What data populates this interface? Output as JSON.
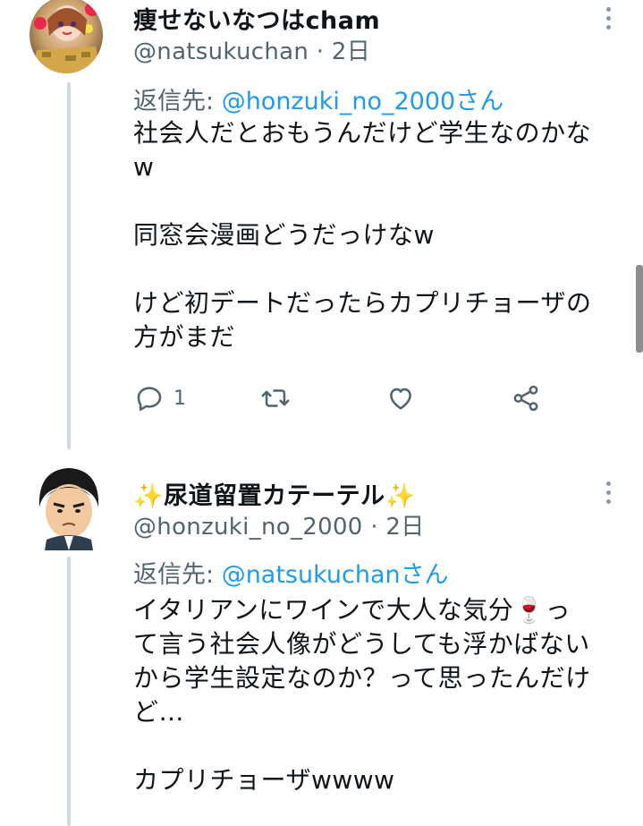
{
  "tweet1": {
    "display_name": "痩せないなつはcham",
    "handle": "@natsukuchan",
    "separator": "·",
    "time": "2日",
    "reply_prefix": "返信先: ",
    "reply_handle": "@honzuki_no_2000さん",
    "body_lines": [
      "社会人だとおもうんだけど学生なのかな",
      "w",
      "",
      "同窓会漫画どうだっけなw",
      "",
      "けど初デートだったらカプリチョーザの",
      "方がまだ"
    ],
    "reply_count": "1"
  },
  "tweet2": {
    "display_name_decor_left": "✨",
    "display_name": "尿道留置カテーテル",
    "display_name_decor_right": "✨",
    "handle": "@honzuki_no_2000",
    "separator": "·",
    "time": "2日",
    "reply_prefix": "返信先: ",
    "reply_handle": "@natsukuchanさん",
    "body_line1_a": "イタリアンにワインで大人な気分",
    "body_line1_emoji": "🍷",
    "body_line1_b": "っ",
    "body_lines": [
      "て言う社会人像がどうしても浮かばない",
      "から学生設定なのか？って思ったんだけ",
      "ど…",
      "",
      "カプリチョーザwwww"
    ]
  }
}
